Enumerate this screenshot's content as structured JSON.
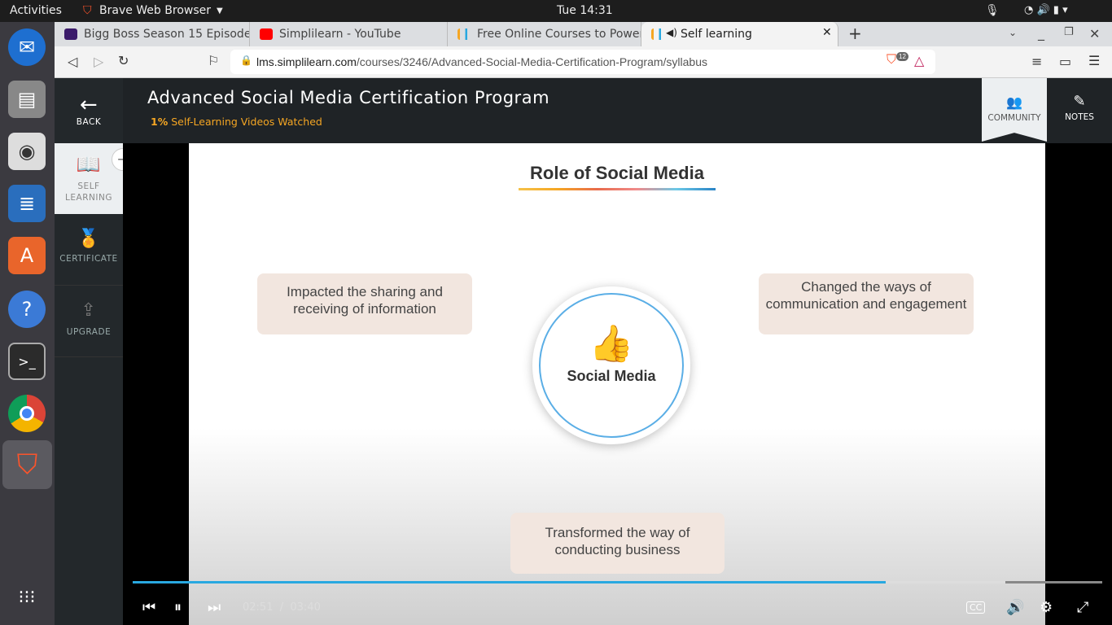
{
  "system": {
    "activities": "Activities",
    "app_name": "Brave Web Browser",
    "clock": "Tue 14:31"
  },
  "browser": {
    "tabs": [
      {
        "label": "Bigg Boss Season 15 Episode",
        "favicon": "voot"
      },
      {
        "label": "Simplilearn - YouTube",
        "favicon": "youtube"
      },
      {
        "label": "Free Online Courses to Power",
        "favicon": "simplilearn"
      },
      {
        "label": "Self learning",
        "favicon": "simplilearn",
        "active": true,
        "audio": true
      }
    ],
    "url_host": "lms.simplilearn.com",
    "url_path": "/courses/3246/Advanced-Social-Media-Certification-Program/syllabus",
    "shields_count": "12"
  },
  "course": {
    "title": "Advanced Social Media Certification Program",
    "progress_percent": "1%",
    "progress_label": "Self-Learning Videos Watched",
    "community": "COMMUNITY",
    "notes": "NOTES",
    "accent": "#f5a623"
  },
  "sidebar": {
    "back": "BACK",
    "items": [
      {
        "label": "SELF LEARNING",
        "active": true
      },
      {
        "label": "CERTIFICATE"
      },
      {
        "label": "UPGRADE"
      }
    ]
  },
  "slide": {
    "title": "Role of Social Media",
    "center": "Social Media",
    "left": "Impacted the sharing and receiving of information",
    "right": "Changed the ways of communication and engagement",
    "bottom": "Transformed the way of conducting business"
  },
  "player": {
    "current": "02:51",
    "separator": "/",
    "duration": "03:40",
    "progress": 0.777,
    "buffered": 0.9
  }
}
